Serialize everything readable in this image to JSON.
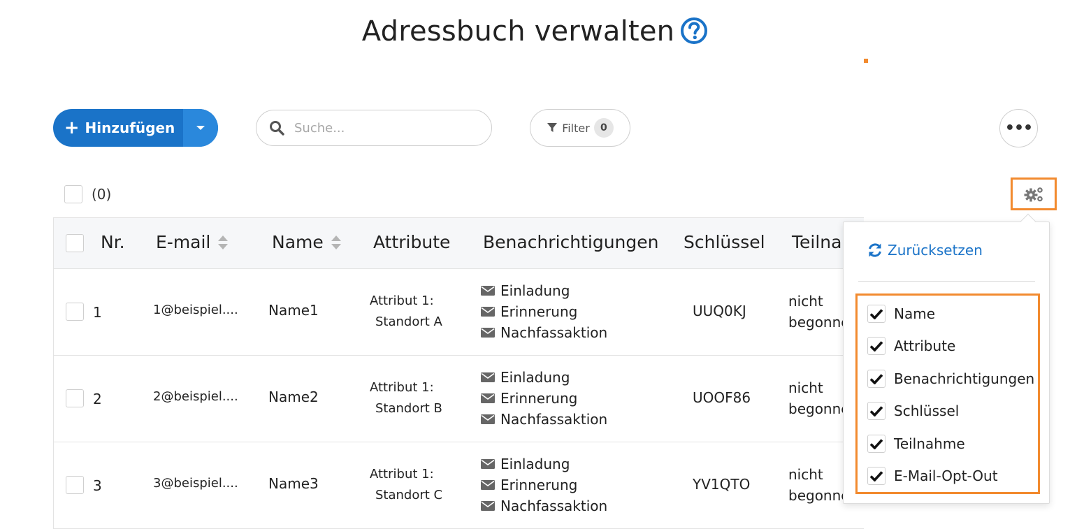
{
  "page": {
    "title": "Adressbuch verwalten",
    "help_icon": "question-circle-icon"
  },
  "toolbar": {
    "add_label": "Hinzufügen",
    "search_placeholder": "Suche...",
    "filter_label": "Filter",
    "filter_count": "0",
    "more_label": "•••"
  },
  "selection": {
    "count_label": "(0)"
  },
  "table": {
    "headers": {
      "nr": "Nr.",
      "email": "E-mail",
      "name": "Name",
      "attribute": "Attribute",
      "notifications": "Benachrichtigungen",
      "key": "Schlüssel",
      "participation": "Teilna"
    },
    "rows": [
      {
        "nr": "1",
        "email": "1@beispiel....",
        "name": "Name1",
        "attr_label": "Attribut 1:",
        "attr_value": "Standort A",
        "notifications": [
          "Einladung",
          "Erinnerung",
          "Nachfassaktion"
        ],
        "key": "UUQ0KJ",
        "status_line1": "nicht",
        "status_line2": "begonne"
      },
      {
        "nr": "2",
        "email": "2@beispiel....",
        "name": "Name2",
        "attr_label": "Attribut 1:",
        "attr_value": "Standort B",
        "notifications": [
          "Einladung",
          "Erinnerung",
          "Nachfassaktion"
        ],
        "key": "UOOF86",
        "status_line1": "nicht",
        "status_line2": "begonne"
      },
      {
        "nr": "3",
        "email": "3@beispiel....",
        "name": "Name3",
        "attr_label": "Attribut 1:",
        "attr_value": "Standort C",
        "notifications": [
          "Einladung",
          "Erinnerung",
          "Nachfassaktion"
        ],
        "key": "YV1QTO",
        "status_line1": "nicht",
        "status_line2": "begonne"
      }
    ]
  },
  "column_menu": {
    "reset_label": "Zurücksetzen",
    "options": [
      {
        "label": "Name",
        "checked": true
      },
      {
        "label": "Attribute",
        "checked": true
      },
      {
        "label": "Benachrichtigungen",
        "checked": true
      },
      {
        "label": "Schlüssel",
        "checked": true
      },
      {
        "label": "Teilnahme",
        "checked": true
      },
      {
        "label": "E-Mail-Opt-Out",
        "checked": true
      }
    ]
  },
  "colors": {
    "primary": "#1a73c8",
    "highlight": "#f28a2e",
    "header_bg": "#f6f7f9"
  }
}
